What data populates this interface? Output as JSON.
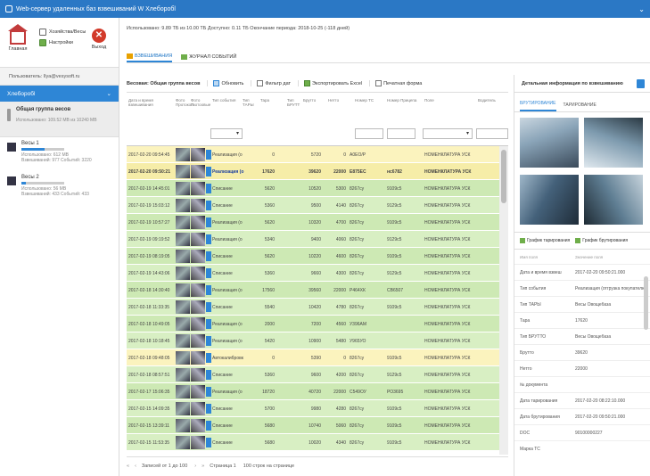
{
  "window": {
    "title": "Web-сервер удаленных баз взвешиваний W Хлеборобl"
  },
  "sidebar": {
    "home_label": "Главная",
    "links": [
      "Хозяйства/Весы",
      "Настройки"
    ],
    "exit_label": "Выход",
    "user": "Пользователь: Ilya@vesysoft.ru",
    "company": "Хлеборобl",
    "group": {
      "name": "Общая группа весов",
      "usage": "Использовано: 109.52 MB из 10240 MB"
    },
    "scales": [
      {
        "name": "Весы 1",
        "usage": "Использовано: 612 MB",
        "stats": "Взвешиваний: 977 Событий: 3220",
        "fill": 0.55
      },
      {
        "name": "Весы 2",
        "usage": "Использовано: 56 MB",
        "stats": "Взвешиваний: 433 Событий: 433",
        "fill": 0.1
      }
    ]
  },
  "header": {
    "info": "Использовано: 9.89 ТБ из 10.00 ТБ Доступно: 0.11 ТБ      Окончание периода: 2018-10-25 (-118 дней)",
    "tabs": [
      "ВЗВЕШИВАНИЯ",
      "ЖУРНАЛ СОБЫТИЙ"
    ]
  },
  "toolbar": {
    "title": "Весовая: Общая группа весов",
    "buttons": [
      "Обновить",
      "Фильтр дат",
      "Экспортировать Excel",
      "Печатная форма"
    ]
  },
  "grid": {
    "headers": [
      "Дата и время взвешивания",
      "Фото Протокол",
      "Фото Гаотоовые",
      "Тип события",
      "Тип ТАРЫ",
      "Тара",
      "Тип БРУТТ",
      "Брутто",
      "Нетто",
      "Номер ТС",
      "Номер Прицепа",
      "Поле",
      "Водитель"
    ],
    "rows": [
      [
        "2017-02-20 09:54:45",
        "Реализация (о",
        "0",
        "5720",
        "0",
        "А0ЕО/Р",
        "",
        "НОМЕНКЛАТУРА УСК"
      ],
      [
        "2017-02-20 09:50:21",
        "Реализация (о",
        "17620",
        "39620",
        "22000",
        "Е875ЕС",
        "нс6782",
        "НОМЕНКЛАТУРА УСК"
      ],
      [
        "2017-02-19 14:45:01",
        "Списание",
        "5620",
        "10520",
        "5300",
        "8267су",
        "9109с5",
        "НОМЕНКЛАТУРА УСК"
      ],
      [
        "2017-02-19 15:03:12",
        "Списание",
        "5360",
        "9500",
        "4140",
        "8267су",
        "9129с5",
        "НОМЕНКЛАТУРА УСК"
      ],
      [
        "2017-02-19 10:57:27",
        "Реализация (о",
        "5620",
        "10320",
        "4700",
        "8267су",
        "9109с5",
        "НОМЕНКЛАТУРА УСК"
      ],
      [
        "2017-02-19 09:19:52",
        "Реализация (о",
        "5340",
        "9400",
        "4060",
        "8267су",
        "9129с5",
        "НОМЕНКЛАТУРА УСК"
      ],
      [
        "2017-02-19 08:19:05",
        "Списание",
        "5620",
        "10220",
        "4600",
        "8267су",
        "9109с5",
        "НОМЕНКЛАТУРА УСК"
      ],
      [
        "2017-02-19 14:43:06",
        "Списание",
        "5360",
        "9660",
        "4300",
        "8267су",
        "9129с5",
        "НОМЕНКЛАТУРА УСК"
      ],
      [
        "2017-02-18 14:30:40",
        "Реализация (о",
        "17560",
        "39560",
        "22000",
        "Р464ХК",
        "СВ6507",
        "НОМЕНКЛАТУРА УСК"
      ],
      [
        "2017-02-18 11:33:35",
        "Списание",
        "5540",
        "10420",
        "4780",
        "8267су",
        "9109с5",
        "НОМЕНКЛАТУРА УСК"
      ],
      [
        "2017-02-18 10:49:05",
        "Реализация (о",
        "2000",
        "7200",
        "4560",
        "У396АМ",
        "",
        "НОМЕНКЛАТУРА УСК"
      ],
      [
        "2017-02-18 10:18:45",
        "Реализация (о",
        "5420",
        "10900",
        "5480",
        "У965УО",
        "",
        "НОМЕНКЛАТУРА УСК"
      ],
      [
        "2017-02-18 09:48:05",
        "Автокалибровк",
        "0",
        "5390",
        "0",
        "8267су",
        "9109с5",
        "НОМЕНКЛАТУРА УСК"
      ],
      [
        "2017-02-18 08:57:51",
        "Списание",
        "5360",
        "9600",
        "4200",
        "8267су",
        "9129с5",
        "НОМЕНКЛАТУРА УСК"
      ],
      [
        "2017-02-17 15:06:35",
        "Реализация (о",
        "18720",
        "40720",
        "22000",
        "С549ОУ",
        "РО3695",
        "НОМЕНКЛАТУРА УСК"
      ],
      [
        "2017-02-15 14:09:35",
        "Списание",
        "5700",
        "9980",
        "4280",
        "8267су",
        "9109с5",
        "НОМЕНКЛАТУРА УСК"
      ],
      [
        "2017-02-15 13:39:11",
        "Списание",
        "5680",
        "10740",
        "5060",
        "8267су",
        "9109с5",
        "НОМЕНКЛАТУРА УСК"
      ],
      [
        "2017-02-15 11:53:35",
        "Списание",
        "5680",
        "10020",
        "4340",
        "8267су",
        "9109с5",
        "НОМЕНКЛАТУРА УСК"
      ]
    ]
  },
  "pager": {
    "records": "Записей от 1 до 100",
    "page": "Страница 1",
    "per_page": "100 строк на странице"
  },
  "detail": {
    "title": "Детальная информация по взвешиванию",
    "tabs": [
      "БРУТИРОВАНИЕ",
      "ТАРИРОВАНИЕ"
    ],
    "charts": [
      "График тарирования",
      "График брутирования"
    ],
    "props_head": [
      "Имя поля",
      "Значение поля"
    ],
    "props": [
      [
        "Дата и время взвеш",
        "2017-02-20 09:50:21.000"
      ],
      [
        "Тип события",
        "Реализация (отгрузка покупателю)"
      ],
      [
        "Тип ТАРЫ",
        "Весы Овощебаза"
      ],
      [
        "Тара",
        "17620"
      ],
      [
        "Тип БРУТТО",
        "Весы Овощебаза"
      ],
      [
        "Брутто",
        "39620"
      ],
      [
        "Нетто",
        "22000"
      ],
      [
        "№ документа",
        ""
      ],
      [
        "Дата тарирования",
        "2017-02-20 08:22:10.000"
      ],
      [
        "Дата брутирования",
        "2017-02-20 09:50:21.000"
      ],
      [
        "DOC",
        "90100000227"
      ],
      [
        "Марка ТС",
        ""
      ]
    ]
  }
}
